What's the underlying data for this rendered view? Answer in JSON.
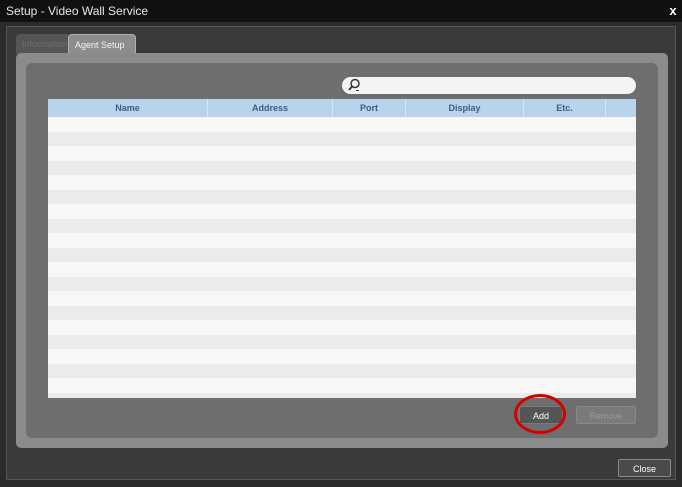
{
  "window": {
    "title": "Setup - Video Wall Service",
    "close_glyph": "x"
  },
  "tabs": [
    {
      "label": "Information",
      "active": false
    },
    {
      "label": "Agent Setup",
      "active": true
    }
  ],
  "search": {
    "value": "",
    "placeholder": ""
  },
  "table": {
    "columns": [
      "Name",
      "Address",
      "Port",
      "Display",
      "Etc."
    ],
    "rows": []
  },
  "buttons": {
    "add": "Add",
    "remove": "Remove",
    "close": "Close"
  },
  "colors": {
    "header_bg": "#b9d3ea",
    "header_text": "#3b5d8a",
    "highlight_circle": "#d50000"
  },
  "icons": {
    "search": "search-icon",
    "close": "close-icon"
  }
}
